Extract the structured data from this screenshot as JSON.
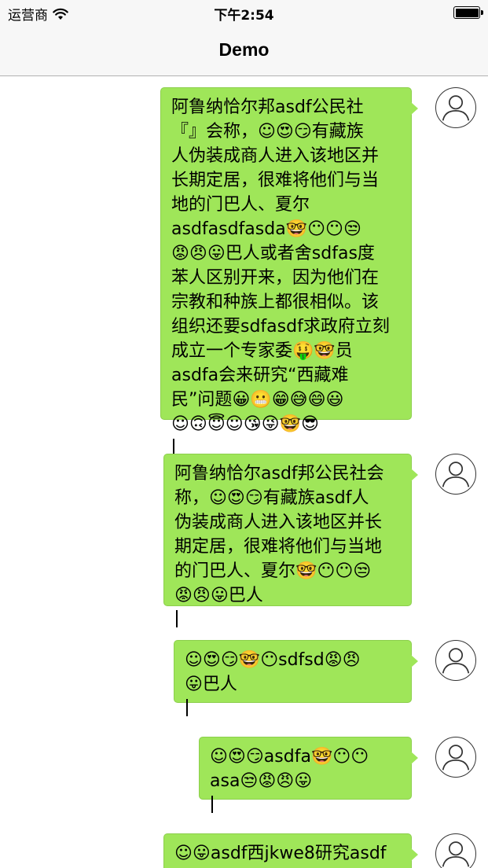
{
  "status_bar": {
    "carrier": "运营商",
    "time": "下午2:54"
  },
  "nav": {
    "title": "Demo"
  },
  "messages": [
    {
      "text": "阿鲁纳恰尔邦asdf公民社\n『』会称，☺😍😏有藏族\n人伪装成商人进入该地区并\n长期定居，很难将他们与当\n地的门巴人、夏尔\nasdfasdfasda🤓😶😶😒\n😡😠😛巴人或者舍sdfas度\n苯人区别开来，因为他们在\n宗教和种族上都很相似。该\n组织还要sdfasdf求政府立刻\n成立一个专家委🤑🤓员\nasdfa会来研究“西藏难\n民”问题😀😬😁😅😄😃\n☺🙃😇☺😘😜🤓😎"
    },
    {
      "text": "阿鲁纳恰尔asdf邦公民社会\n称，☺😍😏有藏族asdf人\n伪装成商人进入该地区并长\n期定居，很难将他们与当地\n的门巴人、夏尔🤓😶😶😒\n😡😠😛巴人"
    },
    {
      "text": "☺😍😏🤓😶sdfsd😡😠\n😛巴人"
    },
    {
      "text": "☺😍😏asdfa🤓😶😶\nasa😒😡😠😛"
    },
    {
      "text": "☺😛asdf西jkwe8研究asdf"
    }
  ]
}
